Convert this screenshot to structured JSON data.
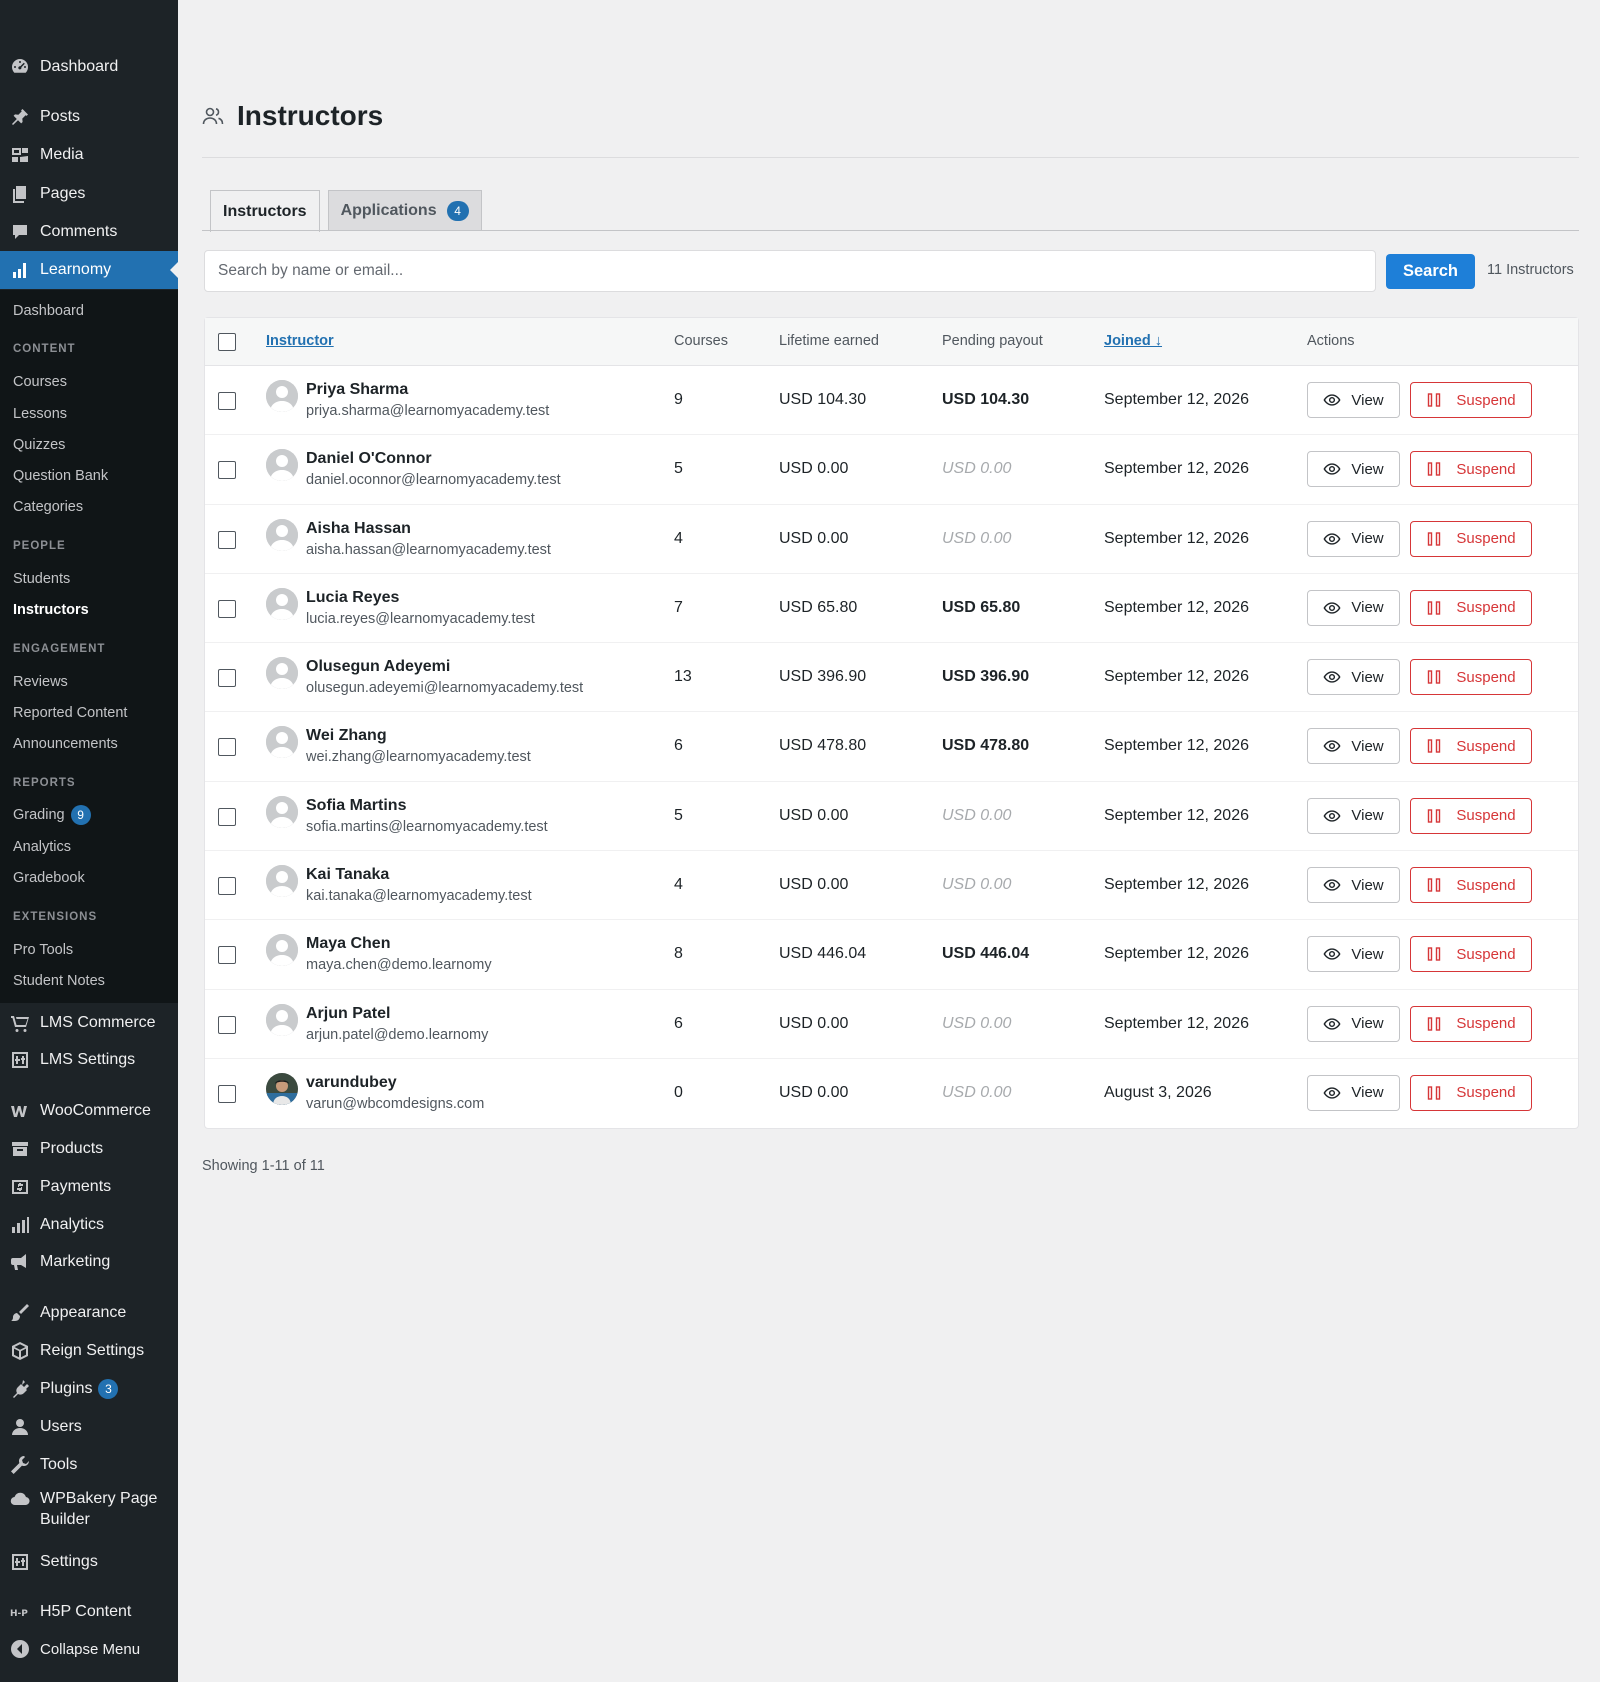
{
  "sidebar": {
    "top_menu": [
      {
        "label": "Dashboard",
        "icon": "dashboard-icon"
      },
      {
        "label": "Posts",
        "icon": "pin-icon"
      },
      {
        "label": "Media",
        "icon": "media-icon"
      },
      {
        "label": "Pages",
        "icon": "pages-icon"
      },
      {
        "label": "Comments",
        "icon": "comments-icon"
      },
      {
        "label": "Learnomy",
        "icon": "chart-bars-icon"
      }
    ],
    "submenu": {
      "dashboard": "Dashboard",
      "content_head": "CONTENT",
      "courses": "Courses",
      "lessons": "Lessons",
      "quizzes": "Quizzes",
      "question_bank": "Question Bank",
      "categories": "Categories",
      "people_head": "PEOPLE",
      "students": "Students",
      "instructors": "Instructors",
      "engagement_head": "ENGAGEMENT",
      "reviews": "Reviews",
      "reported_content": "Reported Content",
      "announcements": "Announcements",
      "reports_head": "REPORTS",
      "grading": "Grading",
      "grading_badge": "9",
      "analytics": "Analytics",
      "gradebook": "Gradebook",
      "extensions_head": "EXTENSIONS",
      "pro_tools": "Pro Tools",
      "student_notes": "Student Notes"
    },
    "bottom_menu": {
      "lms_commerce": "LMS Commerce",
      "lms_settings": "LMS Settings",
      "woocommerce": "WooCommerce",
      "products": "Products",
      "payments": "Payments",
      "analytics": "Analytics",
      "marketing": "Marketing",
      "appearance": "Appearance",
      "reign_settings": "Reign Settings",
      "plugins": "Plugins",
      "plugins_badge": "3",
      "users": "Users",
      "tools": "Tools",
      "wpbakery": "WPBakery Page Builder",
      "settings": "Settings",
      "h5p": "H5P Content",
      "collapse": "Collapse Menu"
    }
  },
  "page": {
    "title": "Instructors",
    "tabs": [
      {
        "label": "Instructors",
        "count": ""
      },
      {
        "label": "Applications",
        "count": "4"
      }
    ],
    "search_placeholder": "Search by name or email...",
    "search_button": "Search",
    "count_text": "11 Instructors",
    "showing_text": "Showing 1-11 of 11"
  },
  "table": {
    "headers": {
      "instructor": "Instructor",
      "courses": "Courses",
      "lifetime": "Lifetime earned",
      "pending": "Pending payout",
      "joined": "Joined ↓",
      "actions": "Actions"
    },
    "view_label": "View",
    "suspend_label": "Suspend",
    "rows": [
      {
        "name": "Priya Sharma",
        "email": "priya.sharma@learnomyacademy.test",
        "courses": "9",
        "lifetime": "USD 104.30",
        "pending": "USD 104.30",
        "pending_zero": false,
        "joined": "September 12, 2026",
        "photo": false
      },
      {
        "name": "Daniel O'Connor",
        "email": "daniel.oconnor@learnomyacademy.test",
        "courses": "5",
        "lifetime": "USD 0.00",
        "pending": "USD 0.00",
        "pending_zero": true,
        "joined": "September 12, 2026",
        "photo": false
      },
      {
        "name": "Aisha Hassan",
        "email": "aisha.hassan@learnomyacademy.test",
        "courses": "4",
        "lifetime": "USD 0.00",
        "pending": "USD 0.00",
        "pending_zero": true,
        "joined": "September 12, 2026",
        "photo": false
      },
      {
        "name": "Lucia Reyes",
        "email": "lucia.reyes@learnomyacademy.test",
        "courses": "7",
        "lifetime": "USD 65.80",
        "pending": "USD 65.80",
        "pending_zero": false,
        "joined": "September 12, 2026",
        "photo": false
      },
      {
        "name": "Olusegun Adeyemi",
        "email": "olusegun.adeyemi@learnomyacademy.test",
        "courses": "13",
        "lifetime": "USD 396.90",
        "pending": "USD 396.90",
        "pending_zero": false,
        "joined": "September 12, 2026",
        "photo": false
      },
      {
        "name": "Wei Zhang",
        "email": "wei.zhang@learnomyacademy.test",
        "courses": "6",
        "lifetime": "USD 478.80",
        "pending": "USD 478.80",
        "pending_zero": false,
        "joined": "September 12, 2026",
        "photo": false
      },
      {
        "name": "Sofia Martins",
        "email": "sofia.martins@learnomyacademy.test",
        "courses": "5",
        "lifetime": "USD 0.00",
        "pending": "USD 0.00",
        "pending_zero": true,
        "joined": "September 12, 2026",
        "photo": false
      },
      {
        "name": "Kai Tanaka",
        "email": "kai.tanaka@learnomyacademy.test",
        "courses": "4",
        "lifetime": "USD 0.00",
        "pending": "USD 0.00",
        "pending_zero": true,
        "joined": "September 12, 2026",
        "photo": false
      },
      {
        "name": "Maya Chen",
        "email": "maya.chen@demo.learnomy",
        "courses": "8",
        "lifetime": "USD 446.04",
        "pending": "USD 446.04",
        "pending_zero": false,
        "joined": "September 12, 2026",
        "photo": false
      },
      {
        "name": "Arjun Patel",
        "email": "arjun.patel@demo.learnomy",
        "courses": "6",
        "lifetime": "USD 0.00",
        "pending": "USD 0.00",
        "pending_zero": true,
        "joined": "September 12, 2026",
        "photo": false
      },
      {
        "name": "varundubey",
        "email": "varun@wbcomdesigns.com",
        "courses": "0",
        "lifetime": "USD 0.00",
        "pending": "USD 0.00",
        "pending_zero": true,
        "joined": "August 3, 2026",
        "photo": true
      }
    ]
  },
  "colors": {
    "sidebar_bg": "#1d2327",
    "submenu_bg": "#101517",
    "accent": "#2271b1",
    "search_button": "#1e7fd8",
    "danger": "#d63638"
  }
}
